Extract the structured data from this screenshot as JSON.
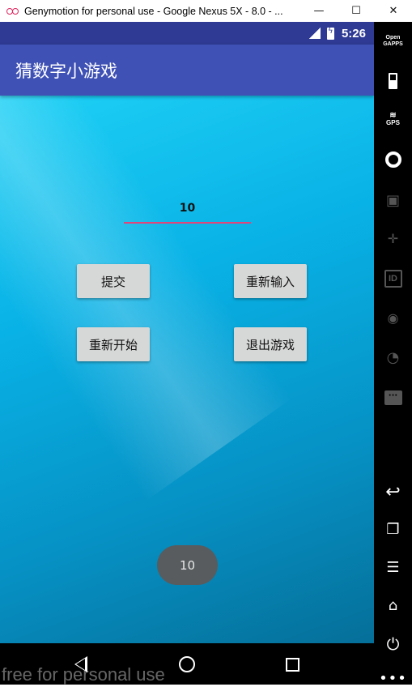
{
  "window": {
    "title": "Genymotion for personal use - Google Nexus 5X - 8.0 - ...",
    "minimize": "—",
    "maximize": "☐",
    "close": "✕"
  },
  "status_bar": {
    "time": "5:26"
  },
  "app": {
    "title": "猜数字小游戏",
    "input_value": "10",
    "buttons": {
      "submit": "提交",
      "reenter": "重新输入",
      "restart": "重新开始",
      "exit": "退出游戏"
    },
    "toast": "10"
  },
  "watermark": "free for personal use",
  "sidebar": {
    "opengapps_line1": "Open",
    "opengapps_line2": "GAPPS",
    "gps_label": "GPS",
    "id_label": "ID"
  },
  "colors": {
    "app_bar": "#3f51b5",
    "status_bar": "#2e3a93",
    "input_underline": "#e2457a",
    "button_bg": "#d6d7d7",
    "toast_bg": "#585c5f"
  }
}
